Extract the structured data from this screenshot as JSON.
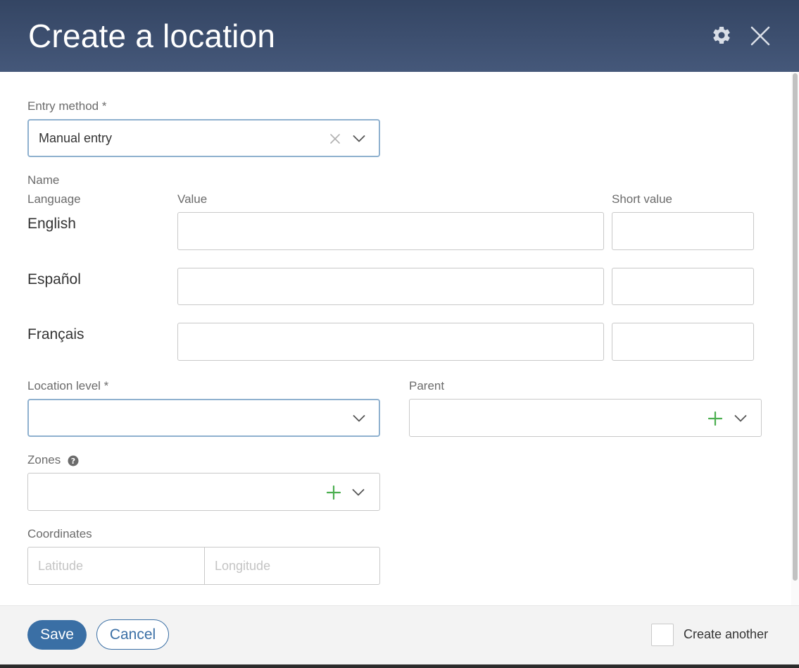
{
  "dialog": {
    "title": "Create a location",
    "icons": {
      "settings": "gear-icon",
      "close": "close-icon"
    }
  },
  "entry_method": {
    "label": "Entry method *",
    "value": "Manual entry"
  },
  "name": {
    "section_label": "Name",
    "column_language": "Language",
    "column_value": "Value",
    "column_short_value": "Short value",
    "rows": [
      {
        "language": "English",
        "value": "",
        "short_value": ""
      },
      {
        "language": "Español",
        "value": "",
        "short_value": ""
      },
      {
        "language": "Français",
        "value": "",
        "short_value": ""
      }
    ]
  },
  "location_level": {
    "label": "Location level *",
    "value": ""
  },
  "parent": {
    "label": "Parent",
    "value": ""
  },
  "zones": {
    "label": "Zones",
    "value": ""
  },
  "coordinates": {
    "label": "Coordinates",
    "latitude_placeholder": "Latitude",
    "longitude_placeholder": "Longitude"
  },
  "footer": {
    "save_label": "Save",
    "cancel_label": "Cancel",
    "create_another_label": "Create another",
    "create_another_checked": false
  },
  "colors": {
    "header": "#3b4d6d",
    "primary": "#3a6fa5",
    "add_icon": "#4caf50",
    "focus_border": "#8fb1cf"
  }
}
